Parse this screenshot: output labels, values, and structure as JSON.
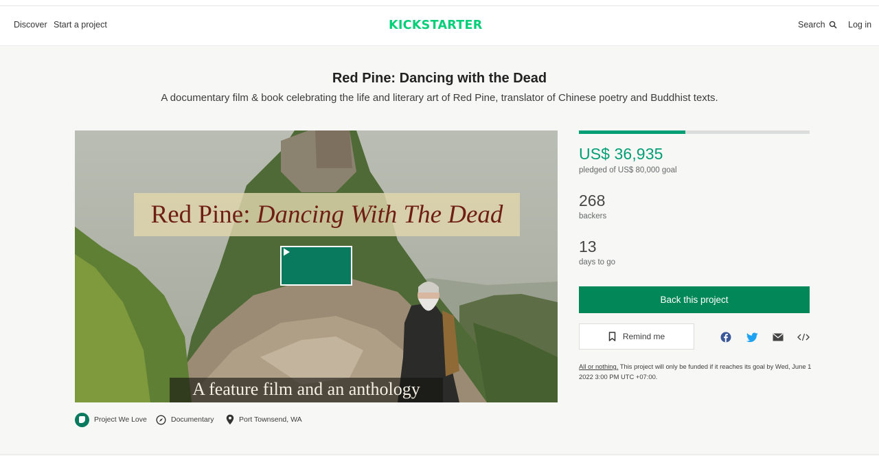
{
  "nav": {
    "discover": "Discover",
    "start_project": "Start a project",
    "logo": "KICKSTARTER",
    "search": "Search",
    "search_icon": "search-icon",
    "login": "Log in"
  },
  "project": {
    "title": "Red Pine: Dancing with the Dead",
    "blurb": "A documentary film & book celebrating the life and literary art of Red Pine, translator of Chinese poetry and Buddhist texts."
  },
  "video": {
    "title_plain": "Red Pine: ",
    "title_italic": "Dancing With The Dead",
    "caption": "A feature film and an anthology",
    "play_icon": "play-icon"
  },
  "tags": {
    "project_we_love": "Project We Love",
    "category": "Documentary",
    "location": "Port Townsend, WA"
  },
  "funding": {
    "progress_fraction": 0.4617,
    "pledged": "US$ 36,935",
    "goal_text": "pledged of US$ 80,000 goal",
    "backers": "268",
    "backers_label": "backers",
    "days": "13",
    "days_label": "days to go",
    "back_button": "Back this project",
    "remind_button": "Remind me"
  },
  "share_icons": [
    "facebook-icon",
    "twitter-icon",
    "email-icon",
    "embed-icon"
  ],
  "all_or_nothing": {
    "link": "All or nothing.",
    "text": " This project will only be funded if it reaches its goal by Wed, June 1 2022 3:00 PM UTC +07:00."
  },
  "colors": {
    "brand_green": "#05ce78",
    "funding_green": "#009e74",
    "button_green": "#028858",
    "play_green": "#0a7a5e"
  }
}
